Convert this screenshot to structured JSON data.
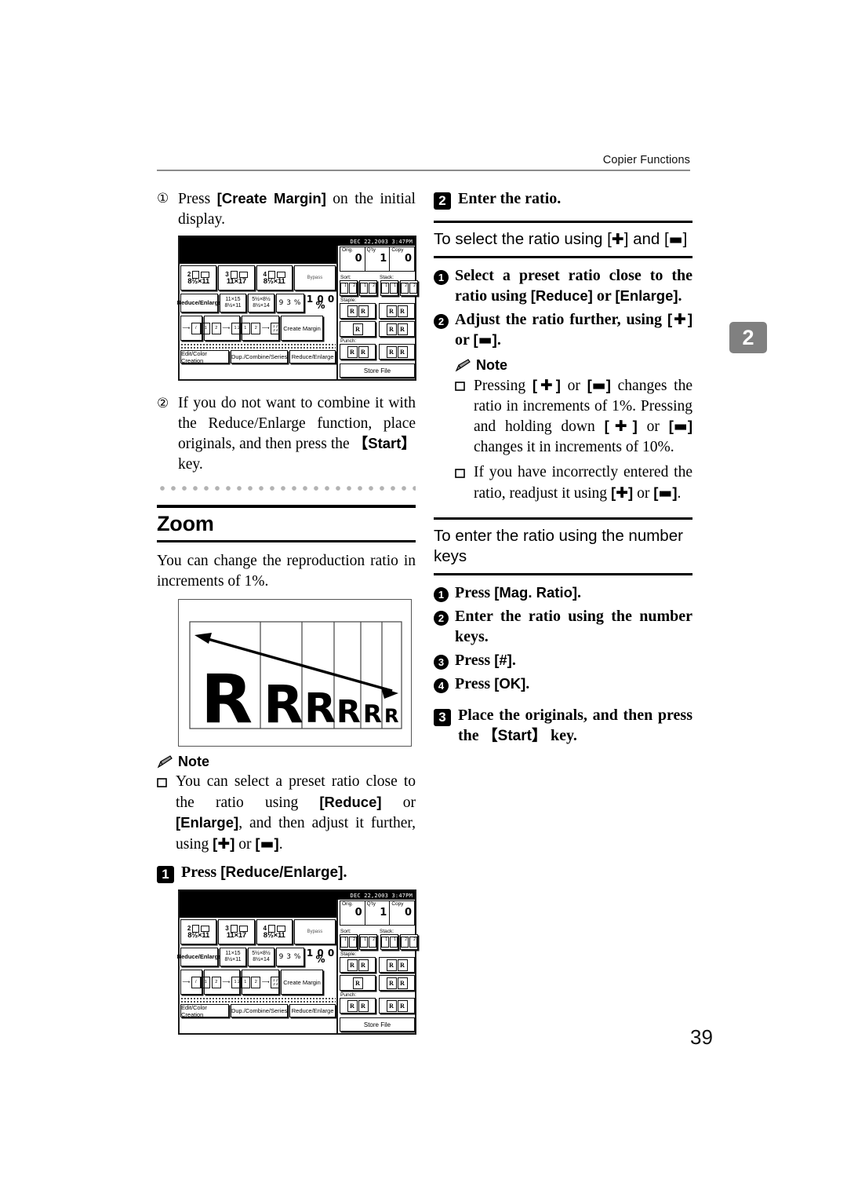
{
  "header": {
    "running_head": "Copier Functions"
  },
  "thumb_tab": {
    "label": "2",
    "color": "#808080"
  },
  "page_number": "39",
  "left_column": {
    "step1": {
      "marker": "①",
      "text_before": "Press ",
      "key": "[Create Margin]",
      "text_after": " on the initial display."
    },
    "step2": {
      "marker": "②",
      "text_before": "If you do not want to combine it with the Reduce/Enlarge function, place originals, and then press the ",
      "key": "【Start】",
      "text_after": " key."
    },
    "section": {
      "title": "Zoom",
      "intro": "You can change the reproduction ratio in increments of 1%."
    },
    "note": {
      "label": "Note",
      "items": [
        {
          "parts": [
            "You can select a preset ratio close to the ratio using ",
            "[Reduce]",
            " or ",
            "[Enlarge]",
            ", and then adjust it further, using ",
            "[+]",
            " or ",
            "[−]",
            "."
          ]
        }
      ]
    },
    "step_A": {
      "marker": "1",
      "text_before": "Press ",
      "key": "[Reduce/Enlarge]",
      "text_after": "."
    }
  },
  "right_column": {
    "step_B": {
      "marker": "2",
      "text": "Enter the ratio."
    },
    "subheading_1": "To select the ratio using [+] and [−]",
    "substeps_1": [
      {
        "marker": "1",
        "parts": [
          "Select a preset ratio close to the ratio using ",
          "[Reduce]",
          " or ",
          "[Enlarge]",
          "."
        ]
      },
      {
        "marker": "2",
        "parts": [
          "Adjust the ratio further, using ",
          "[+]",
          " or ",
          "[−]",
          "."
        ]
      }
    ],
    "note": {
      "label": "Note",
      "items": [
        {
          "parts": [
            "Pressing ",
            "[+]",
            " or ",
            "[−]",
            " changes the ratio in increments of 1%. Pressing and holding down ",
            "[+]",
            " or ",
            "[−]",
            " changes it in increments of 10%."
          ]
        },
        {
          "parts": [
            "If you have incorrectly entered the ratio, readjust it using ",
            "[+]",
            " or ",
            "[−]",
            "."
          ]
        }
      ]
    },
    "subheading_2": "To enter the ratio using the number keys",
    "substeps_2": [
      {
        "marker": "1",
        "text_before": "Press ",
        "key": "[Mag. Ratio]",
        "text_after": "."
      },
      {
        "marker": "2",
        "text_before": "Enter the ratio using the number keys.",
        "key": "",
        "text_after": ""
      },
      {
        "marker": "3",
        "text_before": "Press ",
        "key": "[#]",
        "text_after": "."
      },
      {
        "marker": "4",
        "text_before": "Press ",
        "key": "[OK]",
        "text_after": "."
      }
    ],
    "step_C": {
      "marker": "3",
      "text_before": "Place the originals, and then press the ",
      "key": "【Start】",
      "text_after": " key."
    }
  },
  "lcd_panel": {
    "status_date": "DEC  22,2003  3:47PM",
    "counters": [
      {
        "label": "Orig.",
        "value": "0"
      },
      {
        "label": "Q'ty",
        "value": "1"
      },
      {
        "label": "Copy",
        "value": "0"
      }
    ],
    "paper_trays": [
      {
        "num": "2",
        "size": "8½×11"
      },
      {
        "num": "3",
        "size": "11×17"
      },
      {
        "num": "4",
        "size": "8½×11"
      }
    ],
    "bypass_label": "Bypass",
    "reduce_enlarge_label": "Reduce/Enlarge",
    "ratio_presets": [
      {
        "top": "11×15",
        "bottom": "8½×11"
      },
      {
        "top": "5½×8½",
        "bottom": "8½×14"
      }
    ],
    "ratio_93": "9 3 %",
    "ratio_current": "1 0 0 %",
    "create_margin_label": "Create Margin",
    "bottom_tabs": [
      "Edit/Color Creation",
      "Dup./Combine/Series",
      "Reduce/Enlarge"
    ],
    "finishing": {
      "sort_label": "Sort:",
      "stack_label": "Stack:",
      "staple_label": "Staple:",
      "punch_label": "Punch:"
    },
    "store_file_label": "Store File"
  },
  "zoom_figure": {
    "letters": [
      "R",
      "R",
      "R",
      "R",
      "R",
      "R"
    ],
    "arrow": "double-headed diagonal arrow"
  }
}
